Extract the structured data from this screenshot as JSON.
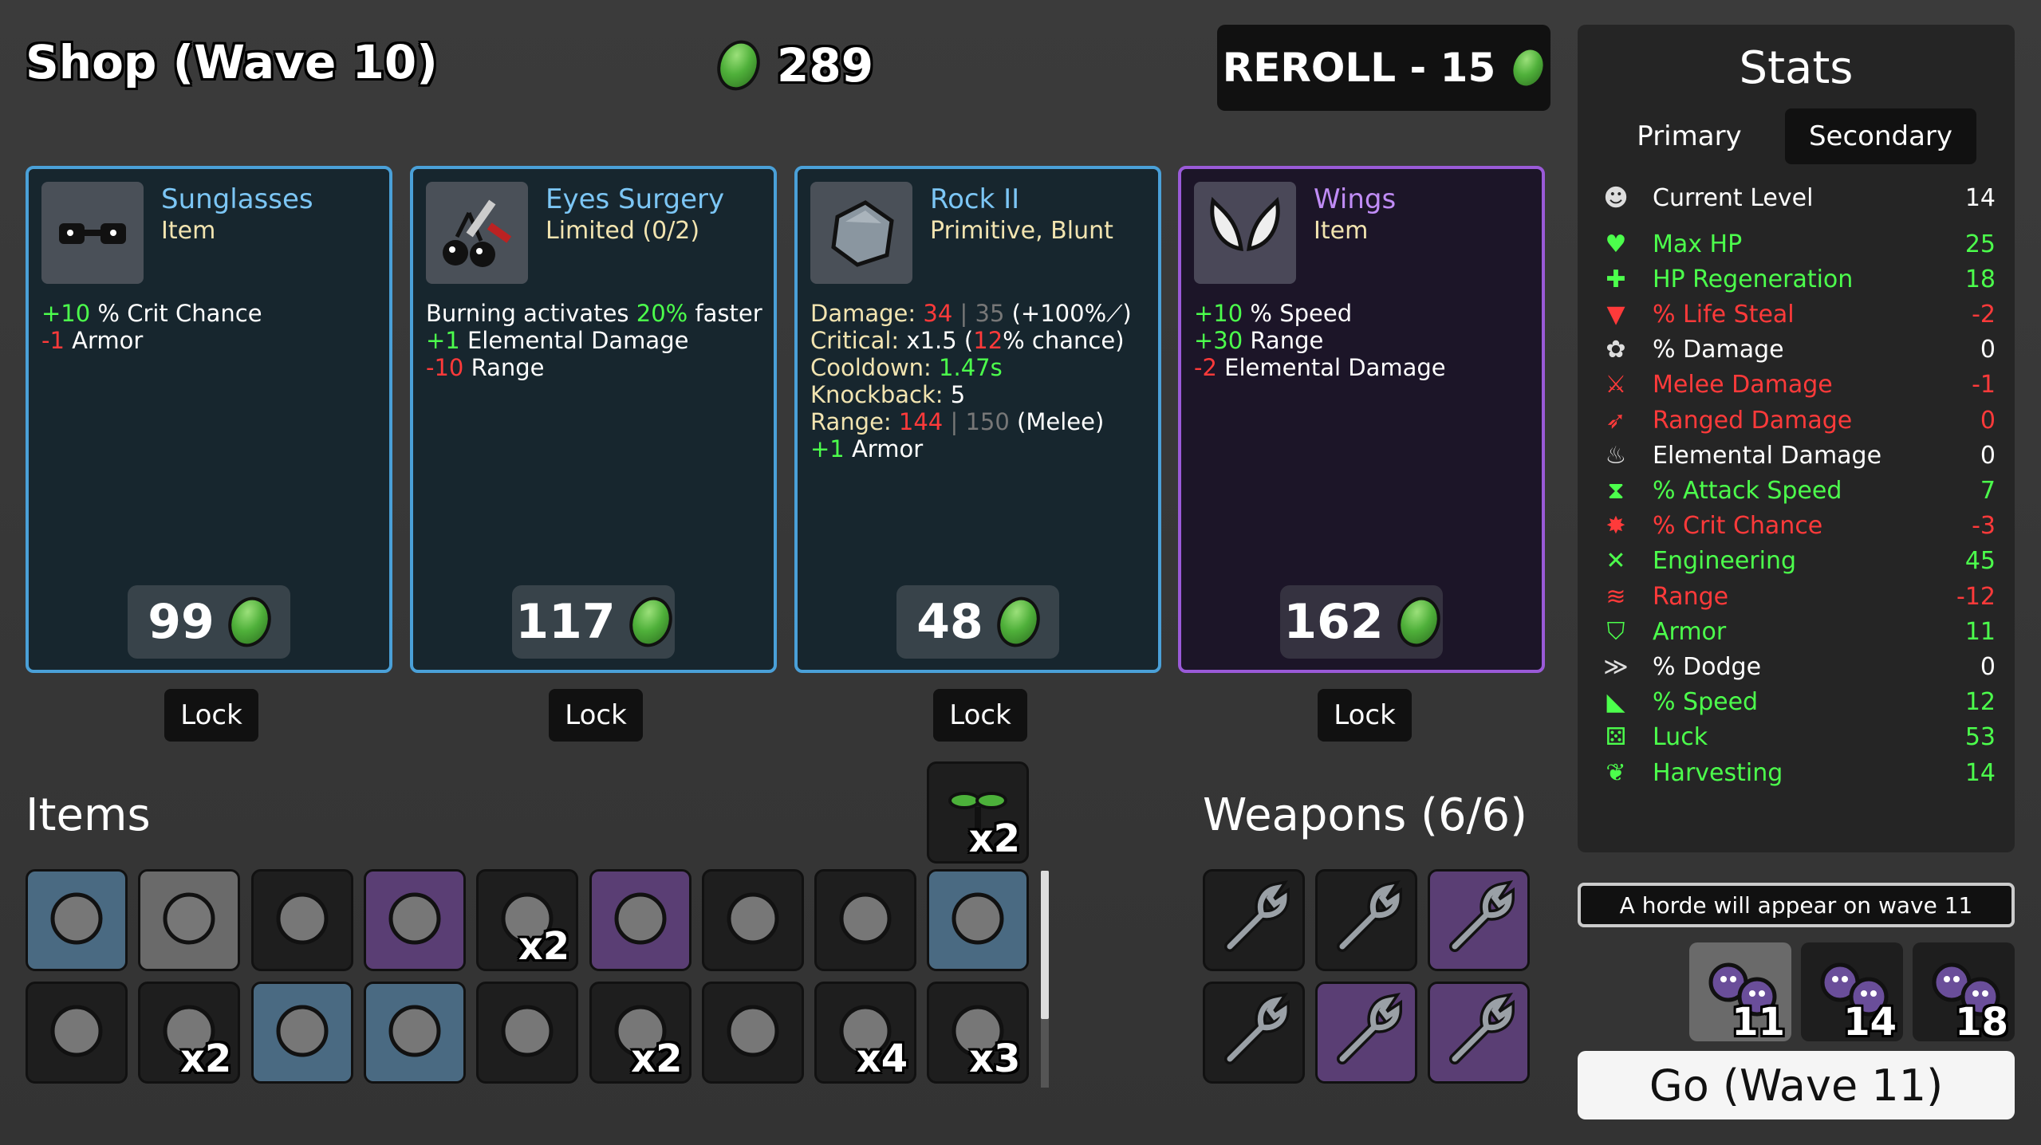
{
  "header": {
    "shop_title": "Shop (Wave 10)",
    "money": "289",
    "reroll_label": "REROLL - 15"
  },
  "shop": [
    {
      "name": "Sunglasses",
      "type": "Item",
      "rarity": "common",
      "lines": [
        [
          {
            "t": "+10",
            "c": "g"
          },
          {
            "t": " % Crit Chance"
          }
        ],
        [
          {
            "t": "-1",
            "c": "r"
          },
          {
            "t": " Armor"
          }
        ]
      ],
      "price": "99",
      "lock": "Lock",
      "icon": "sunglasses-icon"
    },
    {
      "name": "Eyes Surgery",
      "type": "Limited (0/2)",
      "rarity": "common",
      "lines": [
        [
          {
            "t": "Burning activates "
          },
          {
            "t": "20%",
            "c": "g"
          },
          {
            "t": " faster"
          }
        ],
        [
          {
            "t": "+1",
            "c": "g"
          },
          {
            "t": " Elemental Damage"
          }
        ],
        [
          {
            "t": "-10",
            "c": "r"
          },
          {
            "t": " Range"
          }
        ]
      ],
      "price": "117",
      "lock": "Lock",
      "icon": "eyes-surgery-icon"
    },
    {
      "name": "Rock II",
      "type": "Primitive, Blunt",
      "rarity": "common",
      "lines": [
        [
          {
            "t": "Damage: ",
            "c": "y2"
          },
          {
            "t": "34",
            "c": "r"
          },
          {
            "t": " | 35 ",
            "c": "gr"
          },
          {
            "t": "(+100%⟋)"
          }
        ],
        [
          {
            "t": "Critical: ",
            "c": "y2"
          },
          {
            "t": "x1.5 ("
          },
          {
            "t": "12",
            "c": "r"
          },
          {
            "t": "% chance)"
          }
        ],
        [
          {
            "t": "Cooldown: ",
            "c": "y2"
          },
          {
            "t": "1.47s",
            "c": "g"
          }
        ],
        [
          {
            "t": "Knockback: ",
            "c": "y2"
          },
          {
            "t": "5"
          }
        ],
        [
          {
            "t": "Range: ",
            "c": "y2"
          },
          {
            "t": "144",
            "c": "r"
          },
          {
            "t": " | 150 ",
            "c": "gr"
          },
          {
            "t": "(Melee)"
          }
        ],
        [
          {
            "t": "+1",
            "c": "g"
          },
          {
            "t": " Armor"
          }
        ]
      ],
      "price": "48",
      "lock": "Lock",
      "icon": "rock-icon"
    },
    {
      "name": "Wings",
      "type": "Item",
      "rarity": "rare",
      "lines": [
        [
          {
            "t": "+10",
            "c": "g"
          },
          {
            "t": " % Speed"
          }
        ],
        [
          {
            "t": "+30",
            "c": "g"
          },
          {
            "t": " Range"
          }
        ],
        [
          {
            "t": "-2",
            "c": "r"
          },
          {
            "t": " Elemental Damage"
          }
        ]
      ],
      "price": "162",
      "lock": "Lock",
      "icon": "wings-icon"
    }
  ],
  "items_section": {
    "title": "Items",
    "pinned": {
      "icon": "sprout-icon",
      "count": "x2"
    },
    "row1": [
      {
        "icon": "castle-icon",
        "bg": "blue",
        "count": ""
      },
      {
        "icon": "helmet-icon",
        "bg": "gray",
        "count": ""
      },
      {
        "icon": "snake-icon",
        "bg": "dark",
        "count": ""
      },
      {
        "icon": "tools-icon",
        "bg": "purple",
        "count": ""
      },
      {
        "icon": "beanie-icon",
        "bg": "dark",
        "count": "x2"
      },
      {
        "icon": "cat-icon",
        "bg": "purple",
        "count": ""
      },
      {
        "icon": "mushroom-icon",
        "bg": "dark",
        "count": ""
      },
      {
        "icon": "target-icon",
        "bg": "dark",
        "count": ""
      },
      {
        "icon": "snail-icon",
        "bg": "blue",
        "count": ""
      }
    ],
    "row2": [
      {
        "icon": "viking-helmet-icon",
        "bg": "dark",
        "count": ""
      },
      {
        "icon": "scarf-icon",
        "bg": "dark",
        "count": "x2"
      },
      {
        "icon": "rabbit-icon",
        "bg": "blue",
        "count": ""
      },
      {
        "icon": "toxic-rock-icon",
        "bg": "blue",
        "count": ""
      },
      {
        "icon": "tree-icon",
        "bg": "dark",
        "count": ""
      },
      {
        "icon": "cash-icon",
        "bg": "dark",
        "count": "x2"
      },
      {
        "icon": "tooth-icon",
        "bg": "dark",
        "count": ""
      },
      {
        "icon": "whetstone-icon",
        "bg": "dark",
        "count": "x4"
      },
      {
        "icon": "pencil-icon",
        "bg": "dark",
        "count": "x3"
      }
    ]
  },
  "weapons_section": {
    "title": "Weapons (6/6)",
    "slots": [
      "dark",
      "dark",
      "purple",
      "dark",
      "purple",
      "purple"
    ]
  },
  "stats": {
    "title": "Stats",
    "tab_primary": "Primary",
    "tab_secondary": "Secondary",
    "rows": [
      {
        "label": "Current Level",
        "value": "14",
        "color": "#ffffff",
        "icon": "level-icon"
      },
      {
        "label": "Max HP",
        "value": "25",
        "color": "#4cff4c",
        "icon": "heart-icon"
      },
      {
        "label": "HP Regeneration",
        "value": "18",
        "color": "#4cff4c",
        "icon": "regen-icon"
      },
      {
        "label": "% Life Steal",
        "value": "-2",
        "color": "#ff3a3a",
        "icon": "fang-icon"
      },
      {
        "label": "% Damage",
        "value": "0",
        "color": "#ffffff",
        "icon": "brain-icon"
      },
      {
        "label": "Melee Damage",
        "value": "-1",
        "color": "#ff3a3a",
        "icon": "sword-icon"
      },
      {
        "label": "Ranged Damage",
        "value": "0",
        "color": "#ff3a3a",
        "icon": "bow-icon"
      },
      {
        "label": "Elemental Damage",
        "value": "0",
        "color": "#ffffff",
        "icon": "flame-icon"
      },
      {
        "label": "% Attack Speed",
        "value": "7",
        "color": "#4cff4c",
        "icon": "hourglass-icon"
      },
      {
        "label": "% Crit Chance",
        "value": "-3",
        "color": "#ff3a3a",
        "icon": "crit-icon"
      },
      {
        "label": "Engineering",
        "value": "45",
        "color": "#4cff4c",
        "icon": "wrench-cross-icon"
      },
      {
        "label": "Range",
        "value": "-12",
        "color": "#ff3a3a",
        "icon": "range-icon"
      },
      {
        "label": "Armor",
        "value": "11",
        "color": "#4cff4c",
        "icon": "shield-icon"
      },
      {
        "label": "% Dodge",
        "value": "0",
        "color": "#ffffff",
        "icon": "dodge-icon"
      },
      {
        "label": "% Speed",
        "value": "12",
        "color": "#4cff4c",
        "icon": "boot-icon"
      },
      {
        "label": "Luck",
        "value": "53",
        "color": "#4cff4c",
        "icon": "dice-icon"
      },
      {
        "label": "Harvesting",
        "value": "14",
        "color": "#4cff4c",
        "icon": "wheat-icon"
      }
    ]
  },
  "horde": {
    "text": "A horde will appear on wave 11",
    "enemies": [
      {
        "count": "11",
        "icon": "enemy-small-icon",
        "bg": "gray"
      },
      {
        "count": "14",
        "icon": "enemy-pair-icon",
        "bg": "dark"
      },
      {
        "count": "18",
        "icon": "enemy-horned-icon",
        "bg": "dark"
      }
    ]
  },
  "go_label": "Go (Wave 11)",
  "colors": {
    "common_border": "#4aa0d8",
    "rare_border": "#9a5ad8",
    "positive": "#4cff4c",
    "negative": "#ff3a3a"
  }
}
